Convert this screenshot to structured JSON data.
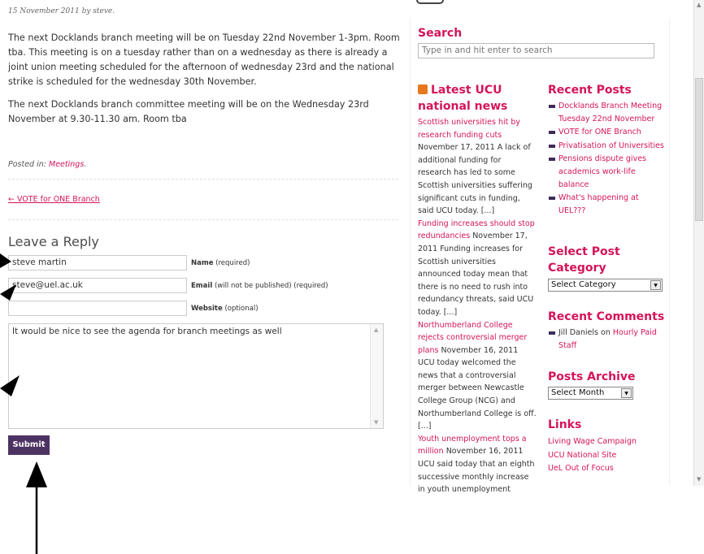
{
  "post": {
    "byline": "15 November 2011 by steve.",
    "paragraph1": "The next Docklands branch meeting will be on Tuesday 22nd November 1-3pm. Room tba. This meeting is on a tuesday rather than on a wednesday as there is already a joint union meeting scheduled for the afternoon of wednesday 23rd and the national strike is scheduled for the wednesday 30th November.",
    "paragraph2": "The next Docklands branch committee meeting will be on the Wednesday 23rd November at 9.30-11.30 am. Room tba",
    "posted_in_label": "Posted in:",
    "posted_in_category": "Meetings",
    "posted_in_suffix": ".",
    "prev_link": "← VOTE for ONE Branch"
  },
  "reply": {
    "title": "Leave a Reply",
    "name_value": "steve martin",
    "name_label": "Name",
    "name_note": "(required)",
    "email_value": "steve@uel.ac.uk",
    "email_label": "Email",
    "email_note": "(will not be published) (required)",
    "website_value": "",
    "website_label": "Website",
    "website_note": "(optional)",
    "comment_value": "It would be nice to see the agenda for branch meetings as well",
    "submit_label": "Submit"
  },
  "sidebar": {
    "search_title": "Search",
    "search_placeholder": "Type in and hit enter to search",
    "news_title": "Latest UCU national news",
    "news": [
      {
        "title": "Scottish universities hit by research funding cuts",
        "date": "November 17, 2011",
        "text": "A lack of additional funding for research has led to some Scottish universities suffering significant cuts in funding, said UCU today. [...]"
      },
      {
        "title": "Funding increases should stop redundancies",
        "date": "November 17, 2011",
        "text": "Funding increases for Scottish universities announced today mean that there is no need to rush into redundancy threats, said UCU today. [...]"
      },
      {
        "title": "Northumberland College rejects controversial merger plans",
        "date": "November 16, 2011",
        "text": "UCU today welcomed the news that a controversial merger between Newcastle College Group (NCG) and Northumberland College is off. [...]"
      },
      {
        "title": "Youth unemployment tops a million",
        "date": "November 16, 2011",
        "text": "UCU said today that an eighth successive monthly increase in youth unemployment figures had to"
      }
    ],
    "recent_posts_title": "Recent Posts",
    "recent_posts": [
      "Docklands Branch Meeting Tuesday 22nd November",
      "VOTE for ONE Branch",
      "Privatisation of Universities",
      "Pensions dispute gives academics work-life balance",
      "What's happening at UEL???"
    ],
    "category_title": "Select Post Category",
    "category_value": "Select Category",
    "comments_title": "Recent Comments",
    "comment_author": "Jill Daniels",
    "comment_on": "on",
    "comment_post": "Hourly Paid Staff",
    "archive_title": "Posts Archive",
    "archive_value": "Select Month",
    "links_title": "Links",
    "links": [
      "Living Wage Campaign",
      "UCU National Site",
      "UeL Out of Focus"
    ]
  },
  "colors": {
    "accent": "#d4145a",
    "button": "#4d3363"
  }
}
